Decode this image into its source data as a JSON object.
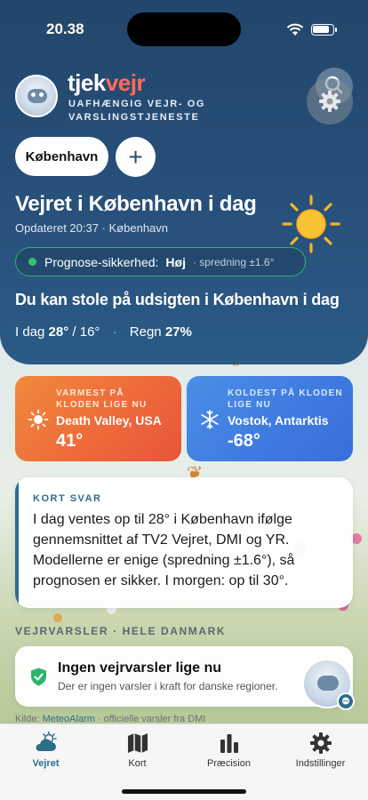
{
  "status_bar": {
    "time": "20.38"
  },
  "header": {
    "brand_part1": "tjek",
    "brand_part2": "vejr",
    "tagline_line1": "UAFHÆNGIG VEJR- OG",
    "tagline_line2": "VARSLINGSTJENESTE",
    "icons": [
      "search-icon",
      "gear-icon"
    ]
  },
  "location": {
    "city_chip": "København",
    "add_label": "+"
  },
  "weather": {
    "headline": "Vejret i København i dag",
    "updated": "Opdateret 20:37 · København",
    "confidence_label": "Prognose-sikkerhed:",
    "confidence_value": "Høj",
    "spread": "· spredning ±1.6°",
    "trust_text": "Du kan stole på udsigten i København i dag",
    "today_label": "I dag",
    "today_high": "28°",
    "today_low": "/ 16°",
    "sep": "·",
    "rain_label": "Regn",
    "rain_value": "27%"
  },
  "extremes": {
    "warm": {
      "label": "VARMEST PÅ KLODEN LIGE NU",
      "place": "Death Valley, USA",
      "temp": "41°"
    },
    "cold": {
      "label": "KOLDEST PÅ KLODEN LIGE NU",
      "place": "Vostok, Antarktis",
      "temp": "-68°"
    }
  },
  "answer": {
    "title": "KORT SVAR",
    "body": "I dag ventes op til 28° i København ifølge gennemsnittet af TV2 Vejret, DMI og YR. Modellerne er enige (spredning ±1.6°), så prognosen er sikker. I morgen: op til 30°."
  },
  "alerts": {
    "section_title": "VEJRVARSLER · HELE DANMARK",
    "title": "Ingen vejrvarsler lige nu",
    "subtitle": "Der er ingen varsler i kraft for danske regioner."
  },
  "source": {
    "prefix": "Kilde: ",
    "link": "MeteoAlarm",
    "suffix": " · officielle varsler fra DMI"
  },
  "tabs": [
    {
      "label": "Vejret",
      "icon": "weather-icon",
      "active": true
    },
    {
      "label": "Kort",
      "icon": "map-icon",
      "active": false
    },
    {
      "label": "Præcision",
      "icon": "bar-chart-icon",
      "active": false
    },
    {
      "label": "Indstillinger",
      "icon": "gear-icon",
      "active": false
    }
  ],
  "colors": {
    "hero": "#27507a",
    "accent": "#2d6d8a",
    "brand_red": "#ff6b5a",
    "confidence_green": "#2fb36b",
    "warm_card": "#ee6a3a",
    "cold_card": "#3f7be0"
  }
}
